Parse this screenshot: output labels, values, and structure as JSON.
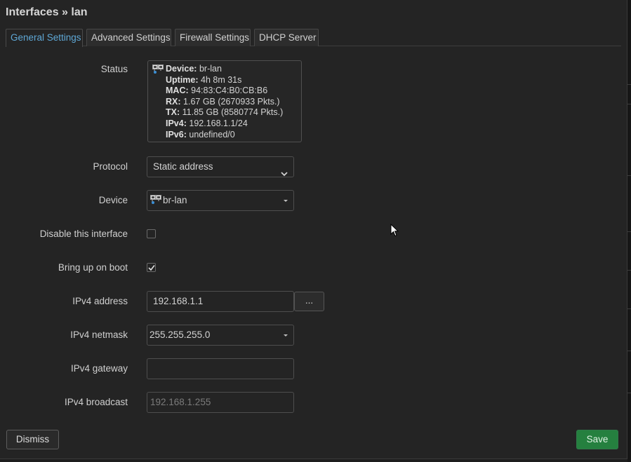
{
  "title": "Interfaces » lan",
  "tabs": [
    {
      "label": "General Settings",
      "active": true
    },
    {
      "label": "Advanced Settings",
      "active": false
    },
    {
      "label": "Firewall Settings",
      "active": false
    },
    {
      "label": "DHCP Server",
      "active": false
    }
  ],
  "status": {
    "label": "Status",
    "icon": "network-device-icon",
    "lines": [
      {
        "key": "Device:",
        "value": "br-lan"
      },
      {
        "key": "Uptime:",
        "value": "4h 8m 31s"
      },
      {
        "key": "MAC:",
        "value": "94:83:C4:B0:CB:B6"
      },
      {
        "key": "RX:",
        "value": "1.67 GB (2670933 Pkts.)"
      },
      {
        "key": "TX:",
        "value": "11.85 GB (8580774 Pkts.)"
      },
      {
        "key": "IPv4:",
        "value": "192.168.1.1/24"
      },
      {
        "key": "IPv6:",
        "value": "undefined/0"
      }
    ]
  },
  "protocol": {
    "label": "Protocol",
    "value": "Static address"
  },
  "device": {
    "label": "Device",
    "value": "br-lan",
    "icon": "network-device-icon"
  },
  "disable_interface": {
    "label": "Disable this interface",
    "checked": false
  },
  "bring_up_on_boot": {
    "label": "Bring up on boot",
    "checked": true
  },
  "ipv4_address": {
    "label": "IPv4 address",
    "value": "192.168.1.1",
    "more_label": "..."
  },
  "ipv4_netmask": {
    "label": "IPv4 netmask",
    "value": "255.255.255.0"
  },
  "ipv4_gateway": {
    "label": "IPv4 gateway",
    "value": ""
  },
  "ipv4_broadcast": {
    "label": "IPv4 broadcast",
    "placeholder": "192.168.1.255"
  },
  "footer": {
    "dismiss_label": "Dismiss",
    "save_label": "Save"
  },
  "colors": {
    "active_tab": "#5fa8d6",
    "save_button": "#25803f",
    "background": "#242424"
  }
}
